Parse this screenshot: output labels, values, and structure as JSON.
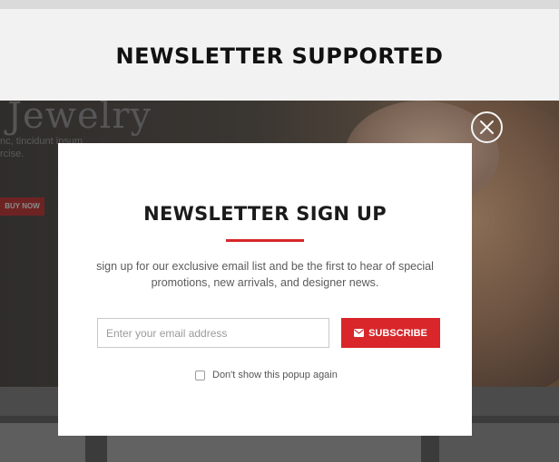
{
  "banner": {
    "title": "NEWSLETTER SUPPORTED"
  },
  "background": {
    "hero_title": "Jewelry",
    "hero_sub_line1": "nc, tincidunt ipsum",
    "hero_sub_line2": "rcise.",
    "buy_label": "BUY NOW"
  },
  "popup": {
    "title": "NEWSLETTER SIGN UP",
    "description": "sign up for our exclusive email list and be the first to hear of special promotions, new arrivals, and designer news.",
    "email_placeholder": "Enter your email address",
    "subscribe_label": "SUBSCRIBE",
    "dont_show_label": "Don't show this popup again",
    "dont_show_checked": false
  },
  "icons": {
    "close": "close-icon",
    "envelope": "envelope-icon"
  },
  "colors": {
    "accent": "#d8262a",
    "banner_bg": "#f2f2f2",
    "overlay": "#3a3a3a"
  }
}
